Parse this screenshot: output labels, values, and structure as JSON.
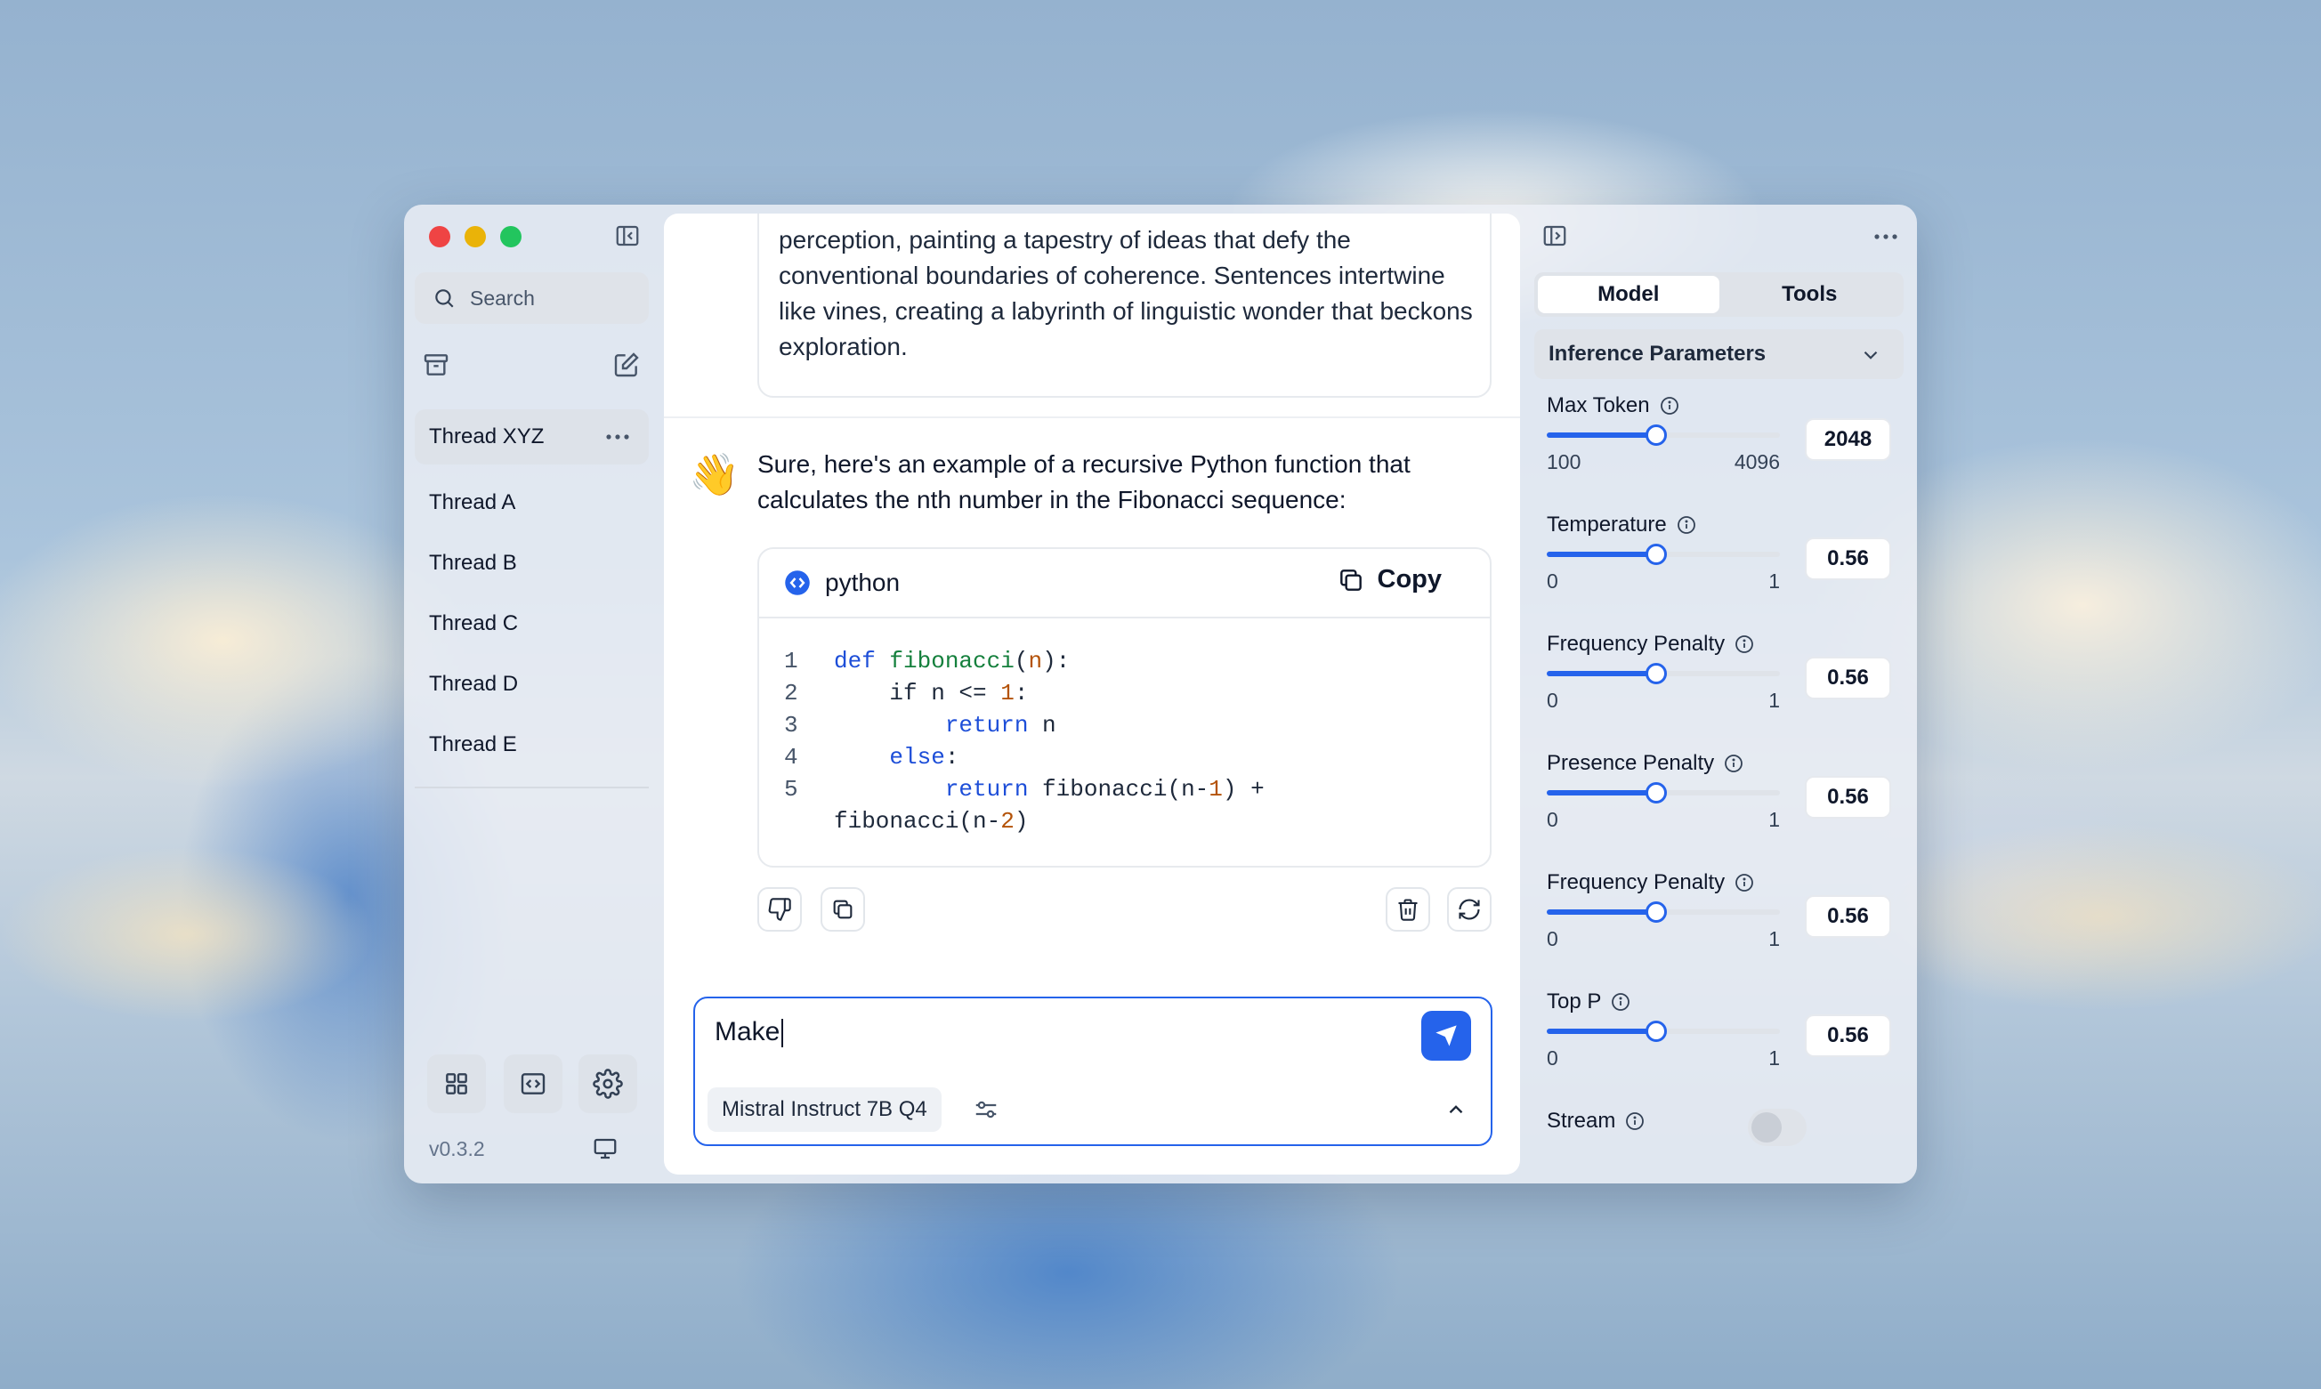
{
  "window": {
    "traffic_lights": [
      "#ef4444",
      "#eab308",
      "#22c55e"
    ]
  },
  "sidebar": {
    "search_placeholder": "Search",
    "threads": [
      {
        "label": "Thread XYZ",
        "active": true
      },
      {
        "label": "Thread A"
      },
      {
        "label": "Thread B"
      },
      {
        "label": "Thread C"
      },
      {
        "label": "Thread D"
      },
      {
        "label": "Thread E"
      }
    ],
    "version": "v0.3.2",
    "bottom_icons": [
      "grid-icon",
      "code-icon",
      "gear-icon"
    ]
  },
  "chat": {
    "previous_message": "abstraction. Words become brushstrokes on the canvas of perception, painting a tapestry of ideas that defy the conventional boundaries of coherence. Sentences intertwine like vines, creating a labyrinth of linguistic wonder that beckons exploration.",
    "assistant_emoji": "👋",
    "assistant_message": "Sure, here's an example of a recursive Python function that calculates the nth number in the Fibonacci sequence:",
    "code": {
      "language": "python",
      "copy_label": "Copy",
      "line_numbers": [
        "1",
        "2",
        "3",
        "4",
        "5"
      ]
    },
    "input_value": "Make",
    "model_name": "Mistral Instruct 7B Q4",
    "accent": "#2563eb"
  },
  "right_panel": {
    "tabs": [
      "Model",
      "Tools"
    ],
    "active_tab": "Model",
    "section_title": "Inference Parameters",
    "params": [
      {
        "label": "Max Token",
        "min": "100",
        "max": "4096",
        "value": "2048",
        "fraction": 0.47
      },
      {
        "label": "Temperature",
        "min": "0",
        "max": "1",
        "value": "0.56",
        "fraction": 0.47
      },
      {
        "label": "Frequency Penalty",
        "min": "0",
        "max": "1",
        "value": "0.56",
        "fraction": 0.47
      },
      {
        "label": "Presence Penalty",
        "min": "0",
        "max": "1",
        "value": "0.56",
        "fraction": 0.47
      },
      {
        "label": "Frequency Penalty",
        "min": "0",
        "max": "1",
        "value": "0.56",
        "fraction": 0.47
      },
      {
        "label": "Top P",
        "min": "0",
        "max": "1",
        "value": "0.56",
        "fraction": 0.47
      }
    ],
    "stream_label": "Stream",
    "stream_enabled": false
  }
}
